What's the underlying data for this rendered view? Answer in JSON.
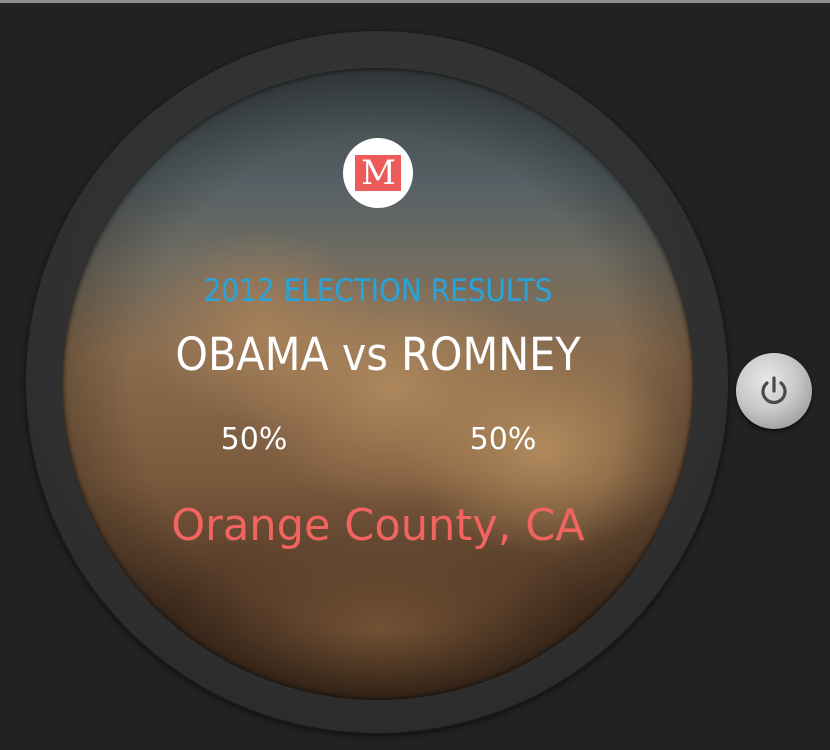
{
  "logo": {
    "letter": "M"
  },
  "watchface": {
    "headline": "2012 ELECTION RESULTS",
    "matchup": "OBAMA vs ROMNEY",
    "percent_left": "50%",
    "percent_right": "50%",
    "location": "Orange County, CA"
  },
  "colors": {
    "background": "#222222",
    "headline": "#27a4dc",
    "location": "#f2645f",
    "logo_accent": "#ec5a5a"
  },
  "icons": {
    "power_button": "power-icon"
  }
}
